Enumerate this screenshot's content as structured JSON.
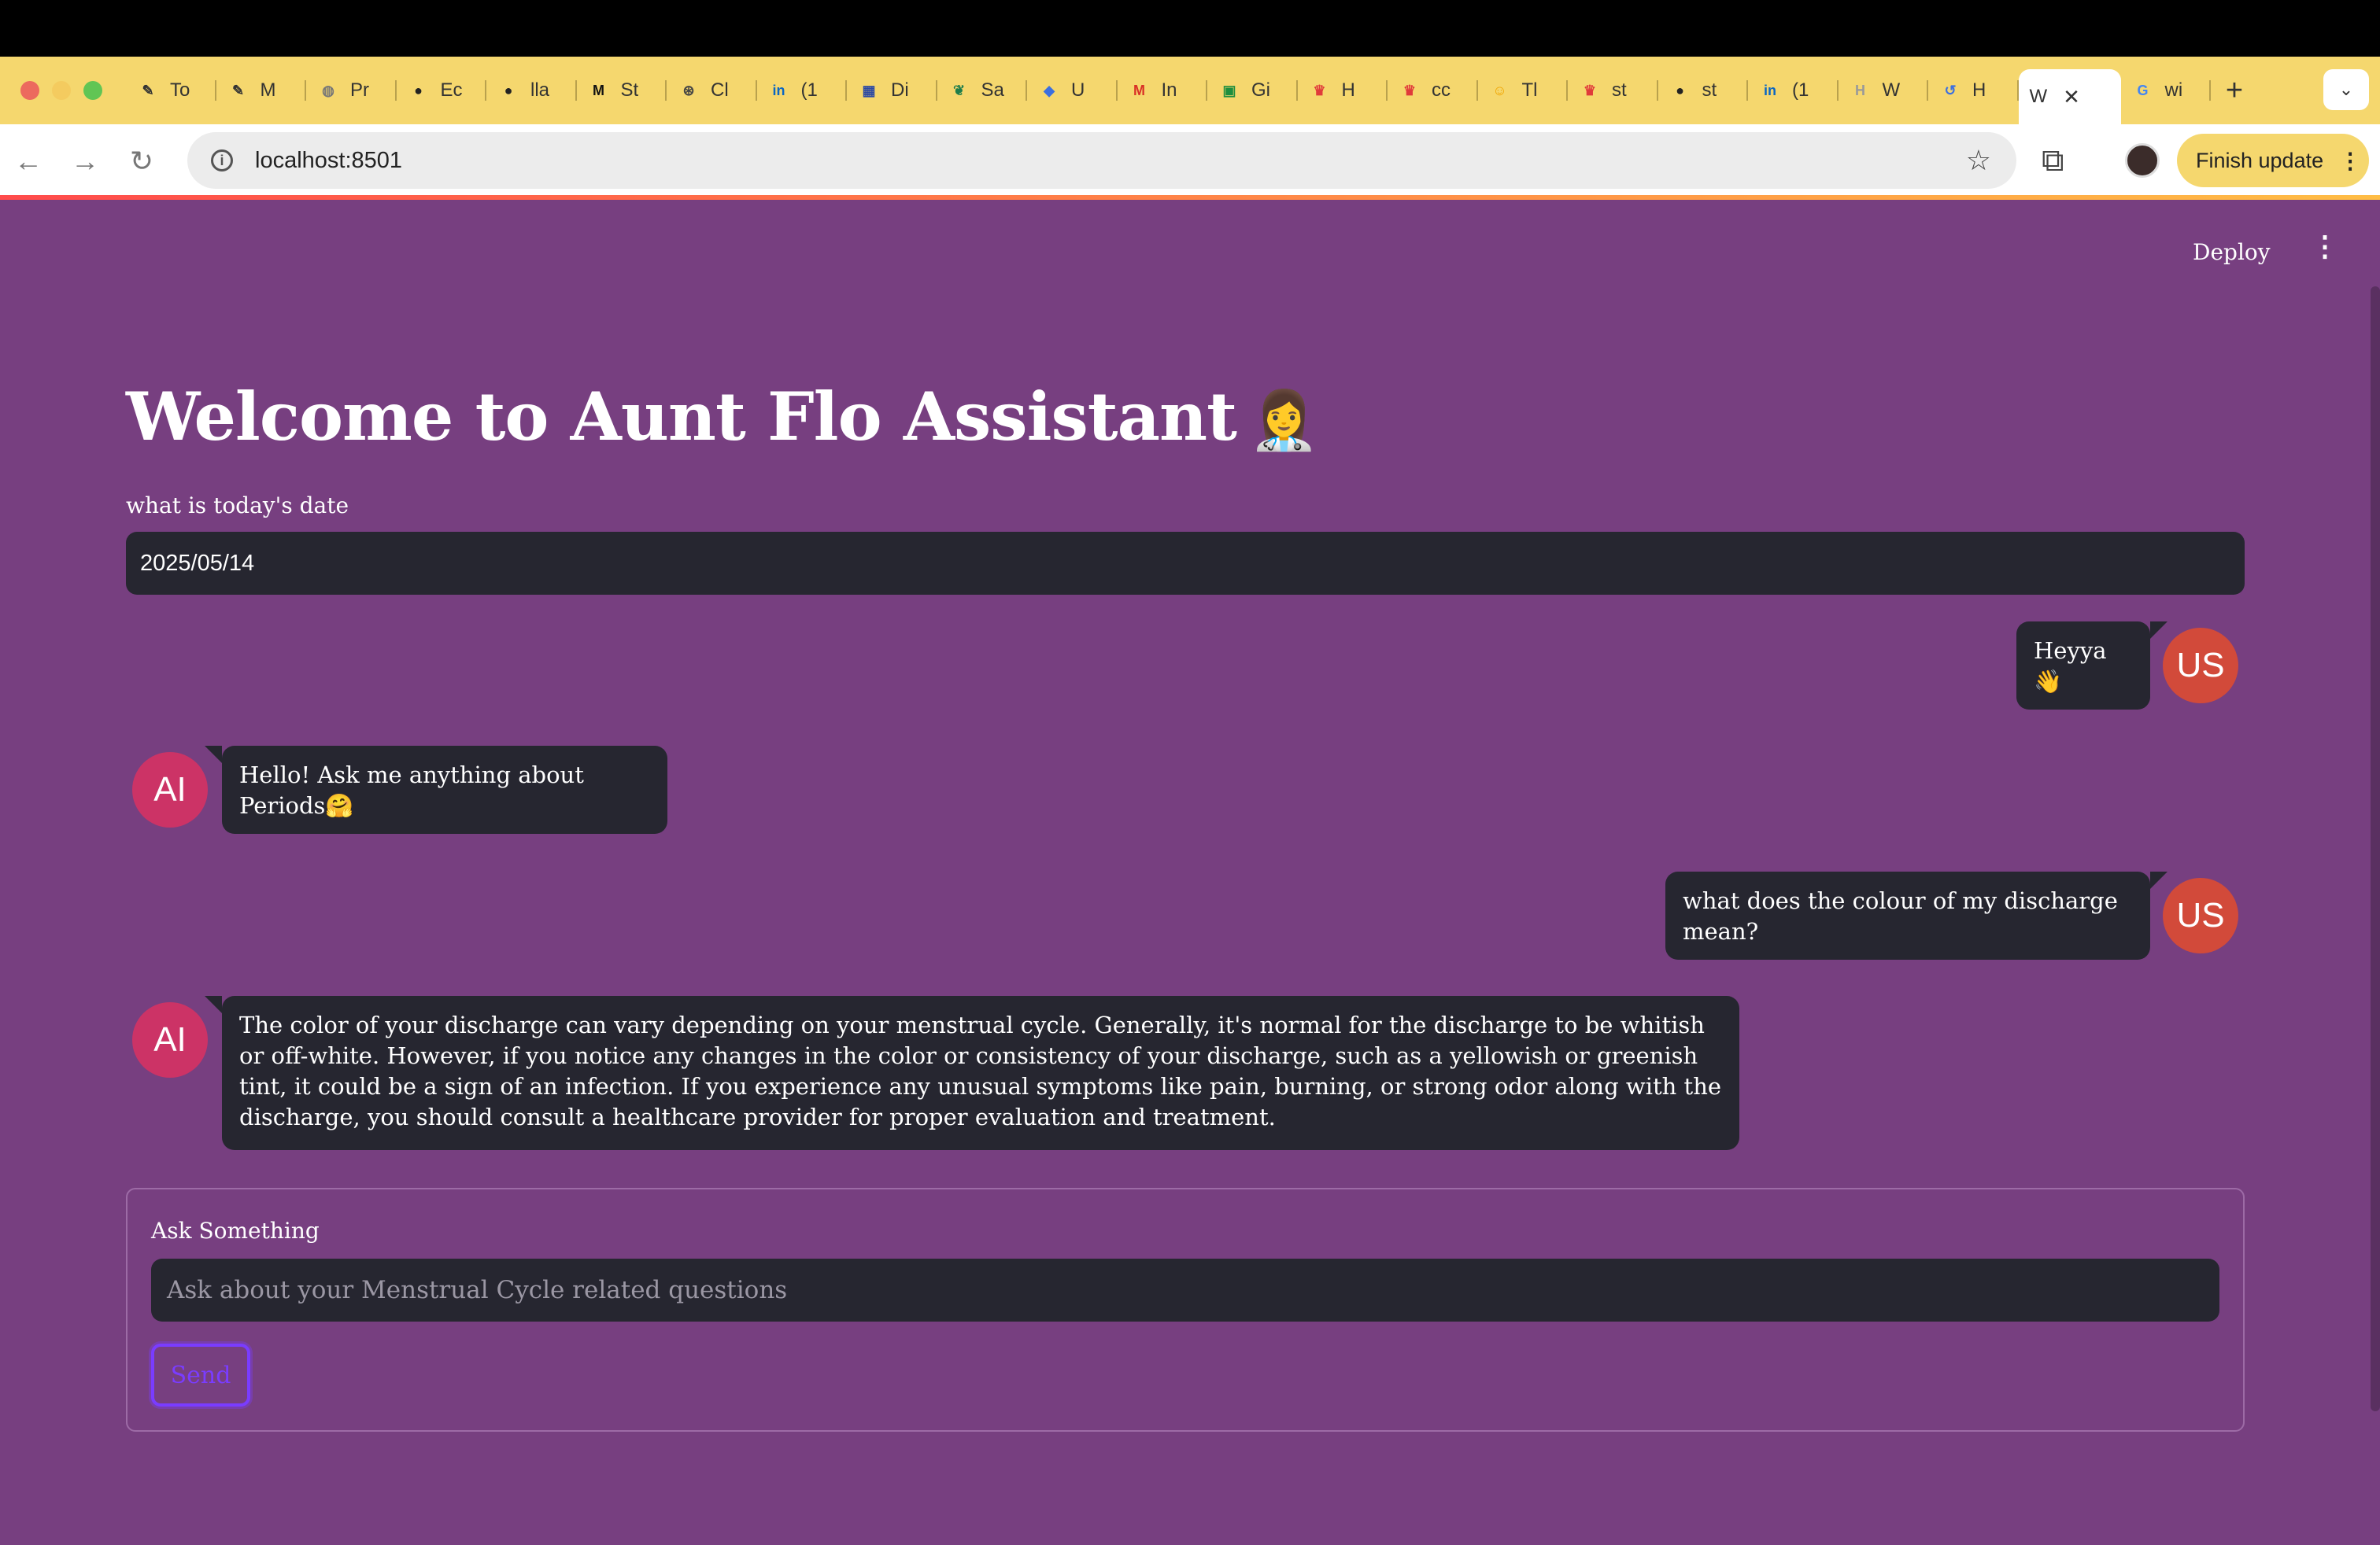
{
  "browser": {
    "tabs": [
      {
        "label": "To",
        "icon": "pen-icon",
        "color": "#333333"
      },
      {
        "label": "M",
        "icon": "pen-icon",
        "color": "#333333"
      },
      {
        "label": "Pr",
        "icon": "globe-icon",
        "color": "#777777"
      },
      {
        "label": "Ec",
        "icon": "github-icon",
        "color": "#222222"
      },
      {
        "label": "lla",
        "icon": "github-icon",
        "color": "#222222"
      },
      {
        "label": "St",
        "icon": "medium-icon",
        "color": "#111111"
      },
      {
        "label": "Cl",
        "icon": "openai-icon",
        "color": "#444444"
      },
      {
        "label": "(1",
        "icon": "linkedin-icon",
        "color": "#0a66c2"
      },
      {
        "label": "Di",
        "icon": "layout-icon",
        "color": "#2d4aa3"
      },
      {
        "label": "Sa",
        "icon": "leaf-icon",
        "color": "#1e7d4a"
      },
      {
        "label": "U",
        "icon": "diamond-icon",
        "color": "#3b6fe0"
      },
      {
        "label": "In",
        "icon": "gmail-icon",
        "color": "#d93025"
      },
      {
        "label": "Gi",
        "icon": "calendar-icon",
        "color": "#1e8e3e"
      },
      {
        "label": "H",
        "icon": "crown-icon",
        "color": "#e03a3a"
      },
      {
        "label": "cc",
        "icon": "crown-icon",
        "color": "#e03a3a"
      },
      {
        "label": "Tl",
        "icon": "emoji-icon",
        "color": "#f0a500"
      },
      {
        "label": "st",
        "icon": "crown-icon",
        "color": "#e03a3a"
      },
      {
        "label": "st",
        "icon": "github-icon",
        "color": "#222222"
      },
      {
        "label": "(1",
        "icon": "linkedin-icon",
        "color": "#0a66c2"
      },
      {
        "label": "W",
        "icon": "h-icon",
        "color": "#999999"
      },
      {
        "label": "H",
        "icon": "history-icon",
        "color": "#3b6fe0"
      }
    ],
    "active_tab": {
      "label": "W",
      "close": "✕"
    },
    "after_tab": {
      "label": "wi",
      "icon": "google-icon"
    },
    "new_tab": "+",
    "url": "localhost:8501",
    "finish_update": "Finish update"
  },
  "app": {
    "deploy": "Deploy",
    "title": "Welcome to Aunt Flo Assistant",
    "title_emoji": "👩‍⚕️",
    "date_label": "what is today's date",
    "date_value": "2025/05/14",
    "messages": [
      {
        "role": "user",
        "avatar": "US",
        "text": "Heyya 👋"
      },
      {
        "role": "ai",
        "avatar": "AI",
        "text": "Hello! Ask me anything about Periods🤗"
      },
      {
        "role": "user",
        "avatar": "US",
        "text": "what does the colour of my discharge mean?"
      },
      {
        "role": "ai",
        "avatar": "AI",
        "text": "The color of your discharge can vary depending on your menstrual cycle. Generally, it's normal for the discharge to be whitish or off-white. However, if you notice any changes in the color or consistency of your discharge, such as a yellowish or greenish tint, it could be a sign of an infection. If you experience any unusual symptoms like pain, burning, or strong odor along with the discharge, you should consult a healthcare provider for proper evaluation and treatment."
      }
    ],
    "form": {
      "label": "Ask Something",
      "placeholder": "Ask about your Menstrual Cycle related questions",
      "send": "Send"
    }
  },
  "colors": {
    "background": "#773f80",
    "bubble": "#262630",
    "user_avatar": "#d24a3a",
    "ai_avatar": "#cc3366",
    "tabstrip": "#f5d76e",
    "send_accent": "#7a3cff"
  }
}
